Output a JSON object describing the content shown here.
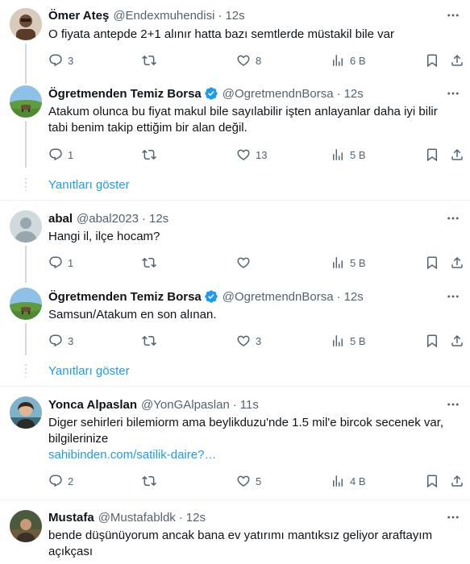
{
  "tweets": [
    {
      "name": "Ömer Ateş",
      "handle": "@Endexmuhendisi",
      "time": "12s",
      "verified": false,
      "text": "O fiyata antepde 2+1 alınır hatta bazı semtlerde müstakil bile var",
      "replies": "3",
      "retweets": "",
      "likes": "8",
      "views": "6 B"
    },
    {
      "name": "Ögretmenden Temiz Borsa",
      "handle": "@OgretmendnBorsa",
      "time": "12s",
      "verified": true,
      "text": "Atakum olunca bu fiyat makul bile sayılabilir işten anlayanlar daha iyi bilir tabi benim takip ettiğim bir alan değil.",
      "replies": "1",
      "retweets": "",
      "likes": "13",
      "views": "5 B"
    },
    {
      "name": "abal",
      "handle": "@abal2023",
      "time": "12s",
      "verified": false,
      "text": "Hangi il, ilçe hocam?",
      "replies": "1",
      "retweets": "",
      "likes": "",
      "views": "5 B"
    },
    {
      "name": "Ögretmenden Temiz Borsa",
      "handle": "@OgretmendnBorsa",
      "time": "12s",
      "verified": true,
      "text": "Samsun/Atakum en son alınan.",
      "replies": "3",
      "retweets": "",
      "likes": "3",
      "views": "5 B"
    },
    {
      "name": "Yonca Alpaslan",
      "handle": "@YonGAlpaslan",
      "time": "11s",
      "verified": false,
      "text": "Diger sehirleri bilemiorm ama beylikduzu'nde 1.5 mil'e bircok secenek var, bilgilerinize",
      "link": "sahibinden.com/satilik-daire?…",
      "replies": "2",
      "retweets": "",
      "likes": "5",
      "views": "4 B"
    },
    {
      "name": "Mustafa",
      "handle": "@Mustafabldk",
      "time": "12s",
      "verified": false,
      "text": "bende düşünüyorum ancak bana  ev yatırımı mantıksız geliyor araftayım açıkçası"
    }
  ],
  "show_replies_label": "Yanıtları göster",
  "separator": "·",
  "colors": {
    "accent": "#1d9bf0",
    "muted": "#536471",
    "text": "#0f1419",
    "line": "#cfd9de"
  }
}
